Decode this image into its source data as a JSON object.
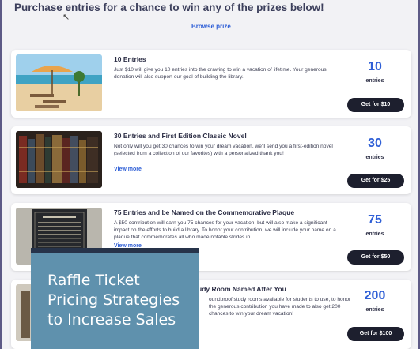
{
  "page": {
    "heading": "Purchase entries for a chance to win any of the prizes below!",
    "browse_label": "Browse prize"
  },
  "cards": [
    {
      "title": "10 Entries",
      "description": "Just $10 will give you 10 entries into the drawing to win a vacation of lifetime. Your generous donation will also support our goal of building the library.",
      "view_more": "",
      "count": "10",
      "entries_label": "entries",
      "button": "Get for $10",
      "image": "beach-umbrella-photo"
    },
    {
      "title": "30 Entries and First Edition Classic Novel",
      "description": "Not only will you get 30 chances to win your dream vacation, we'll send you a first-edition novel (selected from a collection of our favorites) with a personalized thank you!",
      "view_more": "View more",
      "count": "30",
      "entries_label": "entries",
      "button": "Get for $25",
      "image": "old-books-photo"
    },
    {
      "title": "75 Entries and be Named on the Commemorative Plaque",
      "description": "A $50 contribution will earn you 75 chances for your vacation, but will also make a significant impact on the efforts to build a library. To honor your contribution, we will include your name on a plaque that commemorates all who made notable strides in",
      "view_more": "View more",
      "count": "75",
      "entries_label": "entries",
      "button": "Get for $50",
      "image": "plaque-photo"
    },
    {
      "title": "udy Room Named After You",
      "description": "oundproof study rooms available for students to use, to honor the generous contribution you have made to also get 200 chances to win your dream vacation!",
      "view_more": "",
      "count": "200",
      "entries_label": "entries",
      "button": "Get for $100",
      "image": "study-room-photo"
    }
  ],
  "overlay": {
    "line1": "Raffle Ticket",
    "line2": "Pricing Strategies",
    "line3": "to Increase Sales"
  },
  "colors": {
    "accent": "#2f5fd6",
    "button_bg": "#1d1f2e",
    "overlay_bg": "#5f91ad",
    "overlay_bar": "#26334a"
  }
}
